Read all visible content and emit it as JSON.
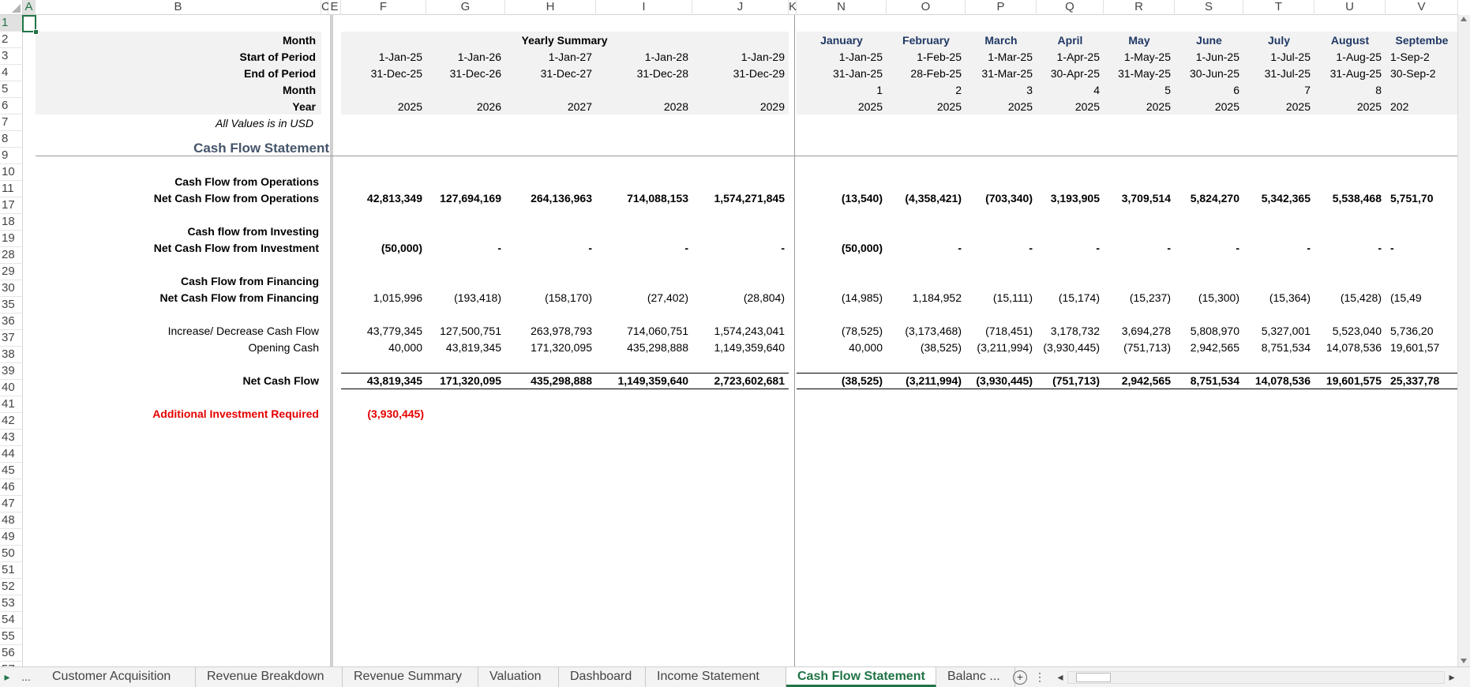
{
  "columns": [
    "A",
    "B",
    "C",
    "E",
    "F",
    "G",
    "H",
    "I",
    "J",
    "K",
    "N",
    "O",
    "P",
    "Q",
    "R",
    "S",
    "T",
    "U",
    "V"
  ],
  "rows": [
    "1",
    "2",
    "3",
    "4",
    "5",
    "6",
    "7",
    "8",
    "9",
    "10",
    "11",
    "17",
    "18",
    "19",
    "28",
    "29",
    "30",
    "35",
    "36",
    "37",
    "38",
    "39",
    "40",
    "41",
    "42",
    "43",
    "44",
    "45",
    "46",
    "47",
    "48",
    "49",
    "50",
    "51",
    "52",
    "53",
    "54",
    "55",
    "56",
    "57"
  ],
  "labels": {
    "month": "Month",
    "start": "Start of Period",
    "end": "End of Period",
    "month_num": "Month",
    "year": "Year",
    "note": "All Values is in USD",
    "title": "Cash Flow Statement",
    "ops_header": "Cash Flow from Operations",
    "ops_net": "Net Cash Flow from Operations",
    "inv_header": "Cash flow from Investing",
    "inv_net": "Net Cash Flow from Investment",
    "fin_header": "Cash Flow from Financing",
    "fin_net": "Net Cash Flow from Financing",
    "incdec": "Increase/ Decrease Cash Flow",
    "opening": "Opening Cash",
    "net": "Net Cash Flow",
    "addl": "Additional Investment Required"
  },
  "yearly": {
    "heading": "Yearly Summary",
    "start": [
      "1-Jan-25",
      "1-Jan-26",
      "1-Jan-27",
      "1-Jan-28",
      "1-Jan-29"
    ],
    "end": [
      "31-Dec-25",
      "31-Dec-26",
      "31-Dec-27",
      "31-Dec-28",
      "31-Dec-29"
    ],
    "year": [
      "2025",
      "2026",
      "2027",
      "2028",
      "2029"
    ],
    "ops": [
      "42,813,349",
      "127,694,169",
      "264,136,963",
      "714,088,153",
      "1,574,271,845"
    ],
    "inv": [
      "(50,000)",
      "-",
      "-",
      "-",
      "-"
    ],
    "fin": [
      "1,015,996",
      "(193,418)",
      "(158,170)",
      "(27,402)",
      "(28,804)"
    ],
    "incdec": [
      "43,779,345",
      "127,500,751",
      "263,978,793",
      "714,060,751",
      "1,574,243,041"
    ],
    "opening": [
      "40,000",
      "43,819,345",
      "171,320,095",
      "435,298,888",
      "1,149,359,640"
    ],
    "net": [
      "43,819,345",
      "171,320,095",
      "435,298,888",
      "1,149,359,640",
      "2,723,602,681"
    ],
    "addl": "(3,930,445)"
  },
  "monthly": {
    "month": [
      "January",
      "February",
      "March",
      "April",
      "May",
      "June",
      "July",
      "August",
      "Septembe"
    ],
    "start": [
      "1-Jan-25",
      "1-Feb-25",
      "1-Mar-25",
      "1-Apr-25",
      "1-May-25",
      "1-Jun-25",
      "1-Jul-25",
      "1-Aug-25",
      "1-Sep-2"
    ],
    "end": [
      "31-Jan-25",
      "28-Feb-25",
      "31-Mar-25",
      "30-Apr-25",
      "31-May-25",
      "30-Jun-25",
      "31-Jul-25",
      "31-Aug-25",
      "30-Sep-2"
    ],
    "month_num": [
      "1",
      "2",
      "3",
      "4",
      "5",
      "6",
      "7",
      "8",
      ""
    ],
    "year": [
      "2025",
      "2025",
      "2025",
      "2025",
      "2025",
      "2025",
      "2025",
      "2025",
      "202"
    ],
    "ops": [
      "(13,540)",
      "(4,358,421)",
      "(703,340)",
      "3,193,905",
      "3,709,514",
      "5,824,270",
      "5,342,365",
      "5,538,468",
      "5,751,70"
    ],
    "inv": [
      "(50,000)",
      "-",
      "-",
      "-",
      "-",
      "-",
      "-",
      "-",
      "-"
    ],
    "fin": [
      "(14,985)",
      "1,184,952",
      "(15,111)",
      "(15,174)",
      "(15,237)",
      "(15,300)",
      "(15,364)",
      "(15,428)",
      "(15,49"
    ],
    "incdec": [
      "(78,525)",
      "(3,173,468)",
      "(718,451)",
      "3,178,732",
      "3,694,278",
      "5,808,970",
      "5,327,001",
      "5,523,040",
      "5,736,20"
    ],
    "opening": [
      "40,000",
      "(38,525)",
      "(3,211,994)",
      "(3,930,445)",
      "(751,713)",
      "2,942,565",
      "8,751,534",
      "14,078,536",
      "19,601,57"
    ],
    "net": [
      "(38,525)",
      "(3,211,994)",
      "(3,930,445)",
      "(751,713)",
      "2,942,565",
      "8,751,534",
      "14,078,536",
      "19,601,575",
      "25,337,78"
    ]
  },
  "tabs": {
    "nav_prev": "▸",
    "nav_more": "...",
    "items": [
      "Customer Acquisition",
      "Revenue Breakdown",
      "Revenue Summary",
      "Valuation",
      "Dashboard",
      "Income Statement",
      "Cash Flow Statement",
      "Balanc ..."
    ],
    "active": "Cash Flow Statement",
    "add": "+",
    "menu": "⋮",
    "scroll_left": "◂",
    "scroll_right": "▸"
  }
}
